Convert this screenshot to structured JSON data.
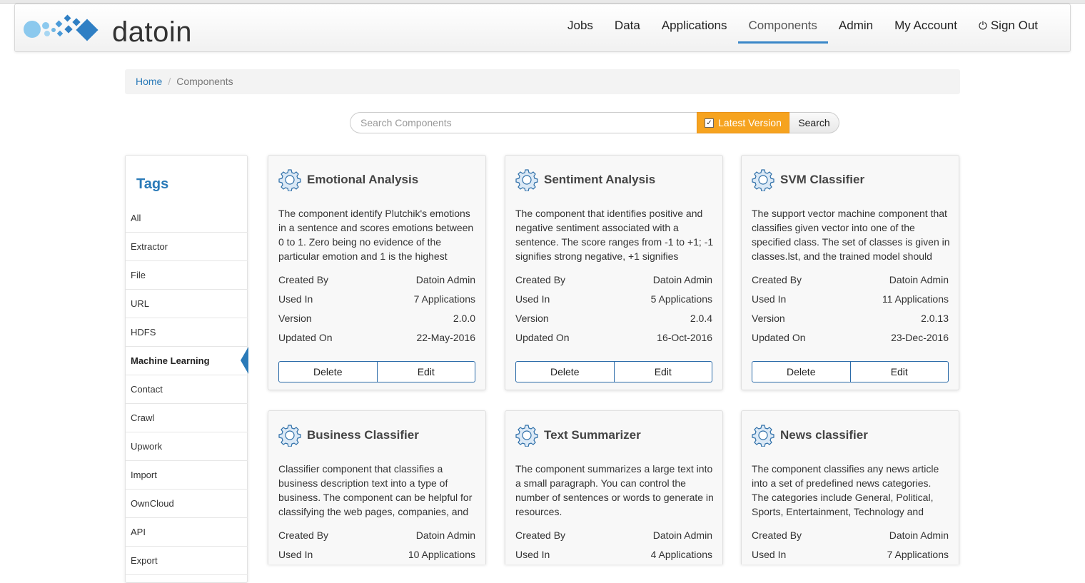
{
  "brand": {
    "name": "datoin"
  },
  "nav": {
    "items": [
      {
        "label": "Jobs"
      },
      {
        "label": "Data"
      },
      {
        "label": "Applications"
      },
      {
        "label": "Components"
      },
      {
        "label": "Admin"
      },
      {
        "label": "My Account"
      },
      {
        "label": "Sign Out"
      }
    ],
    "active": "Components"
  },
  "breadcrumb": {
    "home": "Home",
    "separator": "/",
    "current": "Components"
  },
  "search": {
    "placeholder": "Search Components",
    "latest_label": "Latest Version",
    "latest_checked": true,
    "button": "Search"
  },
  "tags": {
    "title": "Tags",
    "items": [
      "All",
      "Extractor",
      "File",
      "URL",
      "HDFS",
      "Machine Learning",
      "Contact",
      "Crawl",
      "Upwork",
      "Import",
      "OwnCloud",
      "API",
      "Export"
    ],
    "active": "Machine Learning"
  },
  "labels": {
    "created_by": "Created By",
    "used_in": "Used In",
    "version": "Version",
    "updated_on": "Updated On",
    "delete": "Delete",
    "edit": "Edit"
  },
  "components": [
    {
      "title": "Emotional Analysis",
      "description": "The component identify Plutchik's emotions in a sentence and scores emotions between 0 to 1. Zero being no evidence of the particular emotion and 1 is the highest",
      "created_by": "Datoin Admin",
      "used_in": "7 Applications",
      "version": "2.0.0",
      "updated_on": "22-May-2016"
    },
    {
      "title": "Sentiment Analysis",
      "description": "The component that identifies positive and negative sentiment associated with a sentence. The score ranges from -1 to +1; -1 signifies strong negative, +1 signifies",
      "created_by": "Datoin Admin",
      "used_in": "5 Applications",
      "version": "2.0.4",
      "updated_on": "16-Oct-2016"
    },
    {
      "title": "SVM Classifier",
      "description": "The support vector machine component that classifies given vector into one of the specified class. The set of classes is given in classes.lst, and the trained model should",
      "created_by": "Datoin Admin",
      "used_in": "11 Applications",
      "version": "2.0.13",
      "updated_on": "23-Dec-2016"
    },
    {
      "title": "Business Classifier",
      "description": "Classifier component that classifies a business description text into a type of business. The component can be helpful for classifying the web pages, companies, and",
      "created_by": "Datoin Admin",
      "used_in": "10 Applications",
      "version": "",
      "updated_on": ""
    },
    {
      "title": "Text Summarizer",
      "description": "The component summarizes a large text into a small paragraph. You can control the number of sentences or words to generate in resources.",
      "created_by": "Datoin Admin",
      "used_in": "4 Applications",
      "version": "",
      "updated_on": ""
    },
    {
      "title": "News classifier",
      "description": "The component classifies any news article into a set of predefined news categories. The categories include General, Political, Sports, Entertainment, Technology and",
      "created_by": "Datoin Admin",
      "used_in": "7 Applications",
      "version": "",
      "updated_on": ""
    }
  ],
  "colors": {
    "accent": "#2a7ab8",
    "latest_button": "#f6a31f",
    "nav_active_underline": "#3a87c8"
  },
  "icons": {
    "logo": "datoin-logo",
    "power": "power-icon",
    "gear": "gear-icon",
    "checkbox": "checkbox-icon"
  }
}
